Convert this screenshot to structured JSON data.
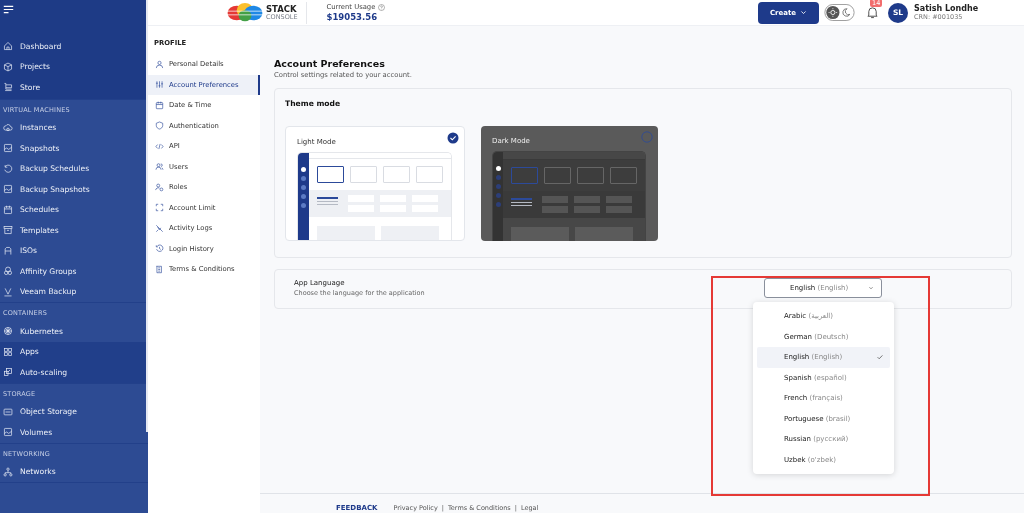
{
  "sidebar": {
    "sections": [
      {
        "items": [
          {
            "label": "Dashboard",
            "selected": false
          },
          {
            "label": "Projects",
            "selected": false
          },
          {
            "label": "Store",
            "selected": false
          }
        ]
      },
      {
        "title": "VIRTUAL MACHINES",
        "items": [
          {
            "label": "Instances",
            "selected": false
          },
          {
            "label": "Snapshots",
            "selected": false
          },
          {
            "label": "Backup Schedules",
            "selected": false
          },
          {
            "label": "Backup Snapshots",
            "selected": false
          },
          {
            "label": "Schedules",
            "selected": false
          },
          {
            "label": "Templates",
            "selected": false
          },
          {
            "label": "ISOs",
            "selected": false
          },
          {
            "label": "Affinity Groups",
            "selected": false
          },
          {
            "label": "Veeam Backup",
            "selected": false
          }
        ]
      },
      {
        "title": "CONTAINERS",
        "items": [
          {
            "label": "Kubernetes",
            "selected": false
          },
          {
            "label": "Apps",
            "selected": true
          },
          {
            "label": "Auto-scaling",
            "selected": true
          }
        ]
      },
      {
        "title": "STORAGE",
        "items": [
          {
            "label": "Object Storage",
            "selected": false
          },
          {
            "label": "Volumes",
            "selected": false
          }
        ]
      },
      {
        "title": "NETWORKING",
        "items": [
          {
            "label": "Networks",
            "selected": false
          }
        ]
      }
    ]
  },
  "header": {
    "logo": {
      "line_1": "STACK",
      "line_2": "CONSOLE"
    },
    "usage_label": "Current Usage",
    "usage_value": "$19053.56",
    "create_button": "Create",
    "notification_count": "14",
    "user": {
      "initials": "SL",
      "name": "Satish Londhe",
      "crn": "CRN: #001035"
    }
  },
  "profile_nav": {
    "title": "PROFILE",
    "items": [
      {
        "label": "Personal Details",
        "selected": false
      },
      {
        "label": "Account Preferences",
        "selected": true
      },
      {
        "label": "Date & Time",
        "selected": false
      },
      {
        "label": "Authentication",
        "selected": false
      },
      {
        "label": "API",
        "selected": false
      },
      {
        "label": "Users",
        "selected": false
      },
      {
        "label": "Roles",
        "selected": false
      },
      {
        "label": "Account Limit",
        "selected": false
      },
      {
        "label": "Activity Logs",
        "selected": false
      },
      {
        "label": "Login History",
        "selected": false
      },
      {
        "label": "Terms & Conditions",
        "selected": false
      }
    ]
  },
  "page": {
    "title": "Account Preferences",
    "subtitle": "Control settings related to your account."
  },
  "theme": {
    "title": "Theme mode",
    "options": [
      {
        "label": "Light Mode",
        "kind": "light",
        "selected": true
      },
      {
        "label": "Dark Mode",
        "kind": "dark",
        "selected": false
      }
    ]
  },
  "language": {
    "title": "App Language",
    "description": "Choose the language for the application",
    "value": "English",
    "value_native": "(English)",
    "expanded": true,
    "options": [
      {
        "name": "Arabic",
        "native": "(العربية)",
        "selected": false
      },
      {
        "name": "German",
        "native": "(Deutsch)",
        "selected": false
      },
      {
        "name": "English",
        "native": "(English)",
        "selected": true
      },
      {
        "name": "Spanish",
        "native": "(español)",
        "selected": false
      },
      {
        "name": "French",
        "native": "(français)",
        "selected": false
      },
      {
        "name": "Portuguese",
        "native": "(brasil)",
        "selected": false
      },
      {
        "name": "Russian",
        "native": "(русский)",
        "selected": false
      },
      {
        "name": "Uzbek",
        "native": "(o'zbek)",
        "selected": false
      }
    ]
  },
  "annotation": {
    "kind": "rectangle",
    "color": "#e53935"
  },
  "footer": {
    "feedback": "FEEDBACK",
    "links": [
      "Privacy Policy",
      "|",
      "Terms & Conditions",
      "|",
      "Legal"
    ]
  }
}
